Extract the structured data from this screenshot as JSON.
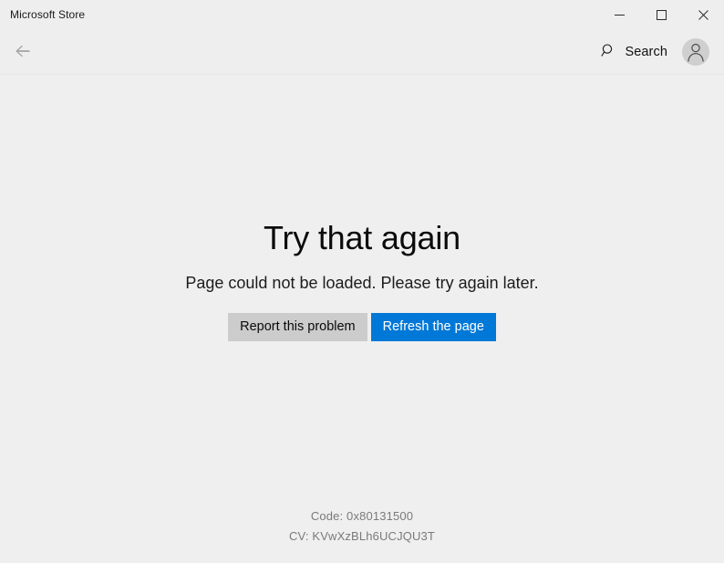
{
  "window": {
    "title": "Microsoft Store",
    "controls": {
      "minimize_label": "Minimize",
      "maximize_label": "Maximize",
      "close_label": "Close"
    }
  },
  "navbar": {
    "back_label": "Back",
    "back_enabled": false,
    "search_label": "Search",
    "account_label": "Account"
  },
  "content": {
    "heading": "Try that again",
    "subtext": "Page could not be loaded. Please try again later.",
    "buttons": {
      "report_label": "Report this problem",
      "refresh_label": "Refresh the page"
    },
    "codes": {
      "error_code": "Code: 0x80131500",
      "correlation_vector": "CV: KVwXzBLh6UCJQU3T"
    }
  },
  "colors": {
    "window_background": "#efefef",
    "chrome_background": "#eeeeee",
    "accent": "#0078d7",
    "secondary_button": "#cccccc",
    "code_text": "#7a7a7a",
    "disabled_glyph": "#a6a6a6"
  }
}
